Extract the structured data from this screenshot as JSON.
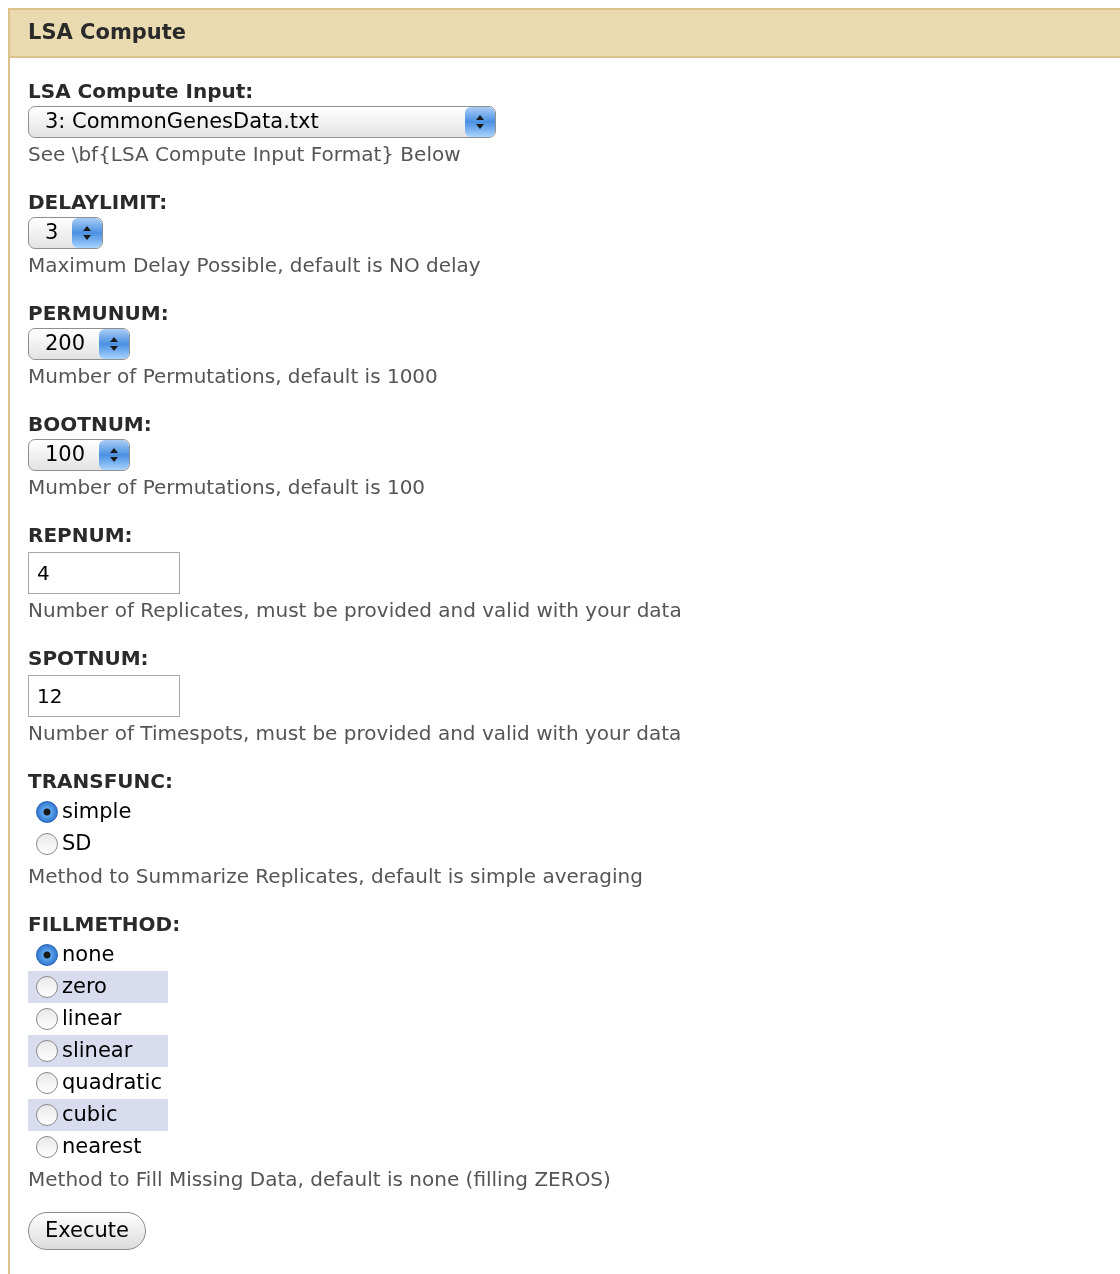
{
  "panel": {
    "title": "LSA Compute"
  },
  "fields": [
    {
      "kind": "select",
      "label": "LSA Compute Input:",
      "value": "3: CommonGenesData.txt",
      "help": "See \\bf{LSA Compute Input Format} Below"
    },
    {
      "kind": "select",
      "label": "DELAYLIMIT:",
      "value": "3",
      "help": "Maximum Delay Possible, default is NO delay"
    },
    {
      "kind": "select",
      "label": "PERMUNUM:",
      "value": "200",
      "help": "Mumber of Permutations, default is 1000"
    },
    {
      "kind": "select",
      "label": "BOOTNUM:",
      "value": "100",
      "help": "Mumber of Permutations, default is 100"
    },
    {
      "kind": "text",
      "label": "REPNUM:",
      "value": "4",
      "help": "Number of Replicates, must be provided and valid with your data"
    },
    {
      "kind": "text",
      "label": "SPOTNUM:",
      "value": "12",
      "help": "Number of Timespots, must be provided and valid with your data"
    },
    {
      "kind": "radio",
      "label": "TRANSFUNC:",
      "options": [
        {
          "label": "simple",
          "selected": true
        },
        {
          "label": "SD",
          "selected": false
        }
      ],
      "help": "Method to Summarize Replicates, default is simple averaging"
    },
    {
      "kind": "radio",
      "label": "FILLMETHOD:",
      "options": [
        {
          "label": "none",
          "selected": true
        },
        {
          "label": "zero",
          "selected": false
        },
        {
          "label": "linear",
          "selected": false
        },
        {
          "label": "slinear",
          "selected": false
        },
        {
          "label": "quadratic",
          "selected": false
        },
        {
          "label": "cubic",
          "selected": false
        },
        {
          "label": "nearest",
          "selected": false
        }
      ],
      "help": "Method to Fill Missing Data, default is none (filling ZEROS)"
    }
  ],
  "button": "Execute"
}
